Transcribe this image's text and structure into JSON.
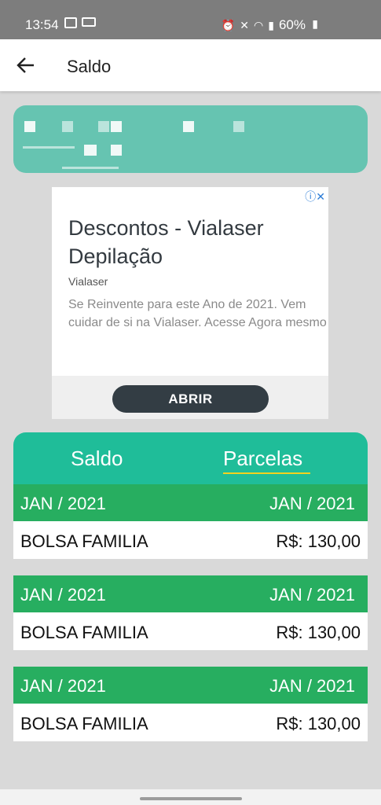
{
  "status_bar": {
    "time": "13:54",
    "battery": "60%",
    "left_icons": [
      "image-icon",
      "laptop-icon"
    ],
    "right_icons": [
      "alarm-icon",
      "mute-icon",
      "wifi-icon",
      "signal-icon",
      "battery-icon"
    ]
  },
  "app_bar": {
    "title": "Saldo",
    "back_icon": "back-arrow-icon"
  },
  "ad": {
    "headline": "Descontos - Vialaser Depilação",
    "advertiser": "Vialaser",
    "body": "Se Reinvente para este Ano de 2021. Vem cuidar de si na Vialaser. Acesse Agora mesmo",
    "cta": "ABRIR",
    "badge": "ⓘ✕"
  },
  "tabs": [
    {
      "label": "Saldo",
      "active": false
    },
    {
      "label": "Parcelas",
      "active": true
    }
  ],
  "entries": [
    {
      "left_date": "JAN / 2021",
      "right_date": "JAN / 2021",
      "benefit": "BOLSA FAMILIA",
      "amount": "R$: 130,00"
    },
    {
      "left_date": "JAN / 2021",
      "right_date": "JAN / 2021",
      "benefit": "BOLSA FAMILIA",
      "amount": "R$: 130,00"
    },
    {
      "left_date": "JAN / 2021",
      "right_date": "JAN / 2021",
      "benefit": "BOLSA FAMILIA",
      "amount": "R$: 130,00"
    }
  ],
  "colors": {
    "status_bar": "#7d7d7d",
    "info_card": "#66c4b1",
    "tabs_bg": "#1fbd99",
    "entry_header": "#27ae60",
    "tab_indicator": "#f2d21f",
    "cta_button": "#333d44"
  }
}
